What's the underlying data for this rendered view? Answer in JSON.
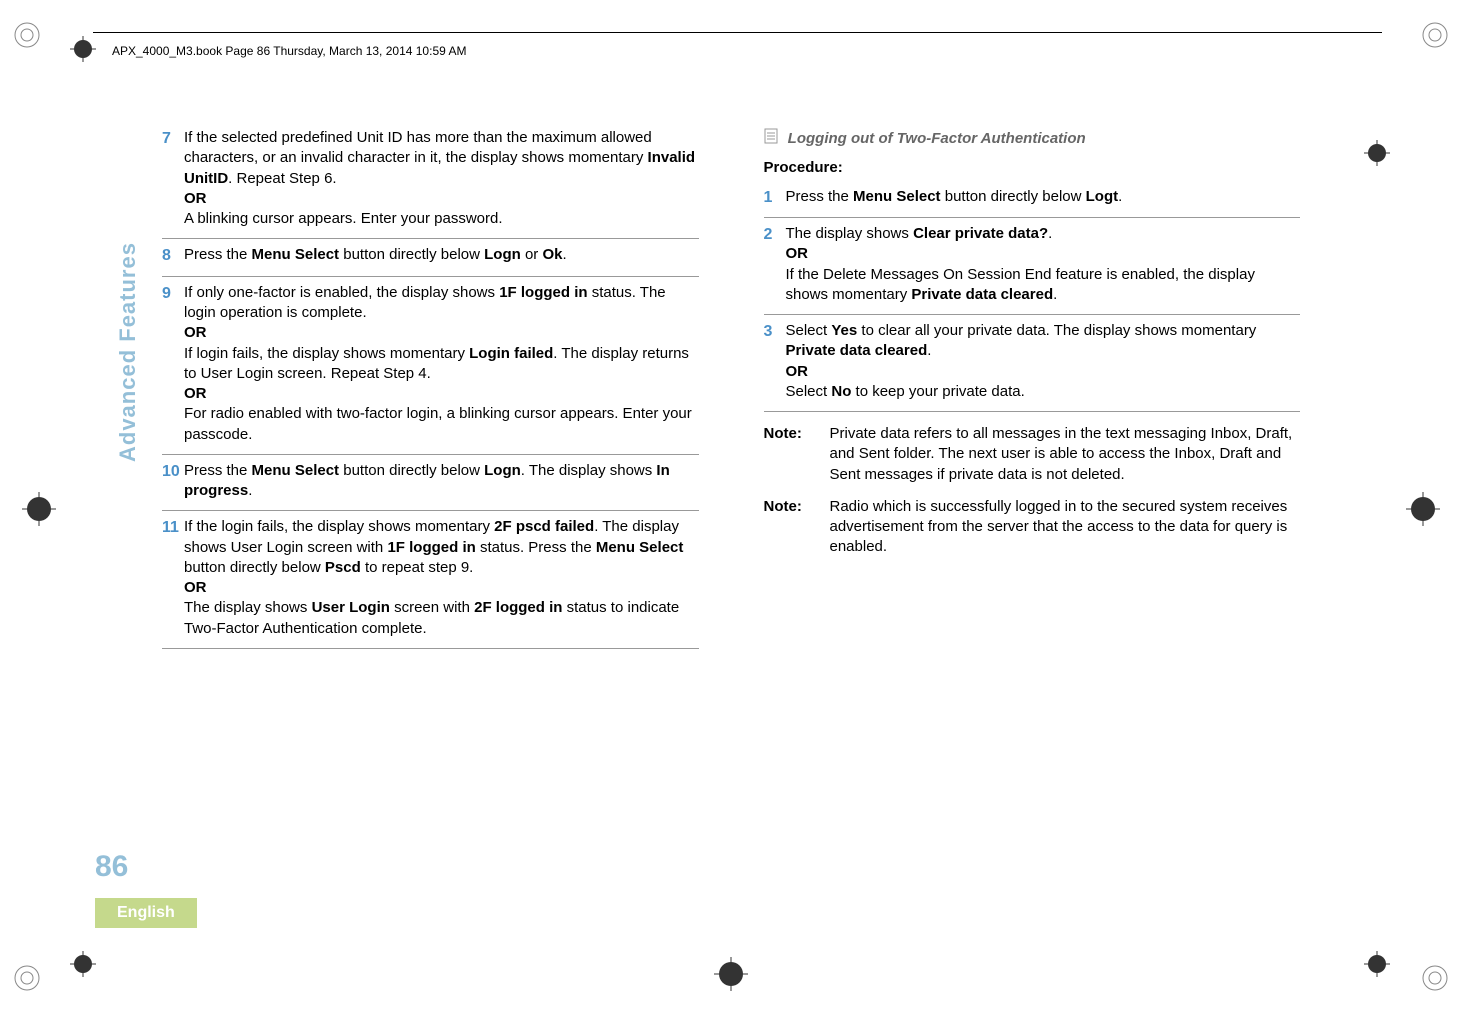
{
  "header": {
    "running": "APX_4000_M3.book  Page 86  Thursday, March 13, 2014  10:59 AM"
  },
  "sidebar": {
    "section": "Advanced Features",
    "page": "86",
    "language": "English"
  },
  "left": {
    "s7": {
      "num": "7",
      "t1": "If the selected predefined Unit ID has more than the maximum allowed characters, or an invalid character in it, the display shows momentary ",
      "u1": "Invalid UnitID",
      "t2": ". Repeat Step 6.",
      "or": "OR",
      "t3": "A blinking cursor appears. Enter your password."
    },
    "s8": {
      "num": "8",
      "t1": "Press the ",
      "b1": "Menu Select",
      "t2": " button directly below ",
      "u1": "Logn",
      "t3": " or ",
      "u2": "Ok",
      "t4": "."
    },
    "s9": {
      "num": "9",
      "t1": "If only one-factor is enabled, the display shows ",
      "u1": "1F logged in",
      "t2": " status. The login operation is complete.",
      "or1": "OR",
      "t3": "If login fails, the display shows momentary ",
      "u2": "Login failed",
      "t4": ". The display returns to User Login screen. Repeat Step 4.",
      "or2": "OR",
      "t5": "For radio enabled with two-factor login, a blinking cursor appears. Enter your passcode."
    },
    "s10": {
      "num": "10",
      "t1": "Press the ",
      "b1": "Menu Select",
      "t2": " button directly below ",
      "u1": "Logn",
      "t3": ". The display shows ",
      "u2": "In progress",
      "t4": "."
    },
    "s11": {
      "num": "11",
      "t1": "If the login fails, the display shows momentary ",
      "u1": "2F pscd failed",
      "t2": ". The display shows User Login screen with ",
      "u2": "1F logged in",
      "t3": " status. Press the ",
      "b1": "Menu Select",
      "t4": " button directly below ",
      "u3": "Pscd",
      "t5": " to repeat step 9.",
      "or": "OR",
      "t6": "The display shows ",
      "u4": "User Login",
      "t7": " screen with ",
      "u5": "2F logged in",
      "t8": " status to indicate Two-Factor Authentication complete."
    }
  },
  "right": {
    "heading": "Logging out of Two-Factor Authentication",
    "procedure": "Procedure:",
    "s1": {
      "num": "1",
      "t1": "Press the ",
      "b1": "Menu Select",
      "t2": " button directly below ",
      "u1": "Logt",
      "t3": "."
    },
    "s2": {
      "num": "2",
      "t1": "The display shows ",
      "u1": "Clear private data?",
      "t2": ".",
      "or": "OR",
      "t3": "If the Delete Messages On Session End feature is enabled, the display shows momentary ",
      "u2": "Private data cleared",
      "t4": "."
    },
    "s3": {
      "num": "3",
      "t1": "Select ",
      "u1": "Yes",
      "t2": " to clear all your private data. The display shows momentary ",
      "u2": "Private data cleared",
      "t3": ".",
      "or": "OR",
      "t4": "Select ",
      "u3": "No",
      "t5": " to keep your private data."
    },
    "note1": {
      "label": "Note:",
      "body": "Private data refers to all messages in the text messaging Inbox, Draft, and Sent folder. The next user is able to access the Inbox, Draft and Sent messages if private data is not deleted."
    },
    "note2": {
      "label": "Note:",
      "body": "Radio which is successfully logged in to the secured system receives advertisement from the server that the access to the data for query is enabled."
    }
  }
}
